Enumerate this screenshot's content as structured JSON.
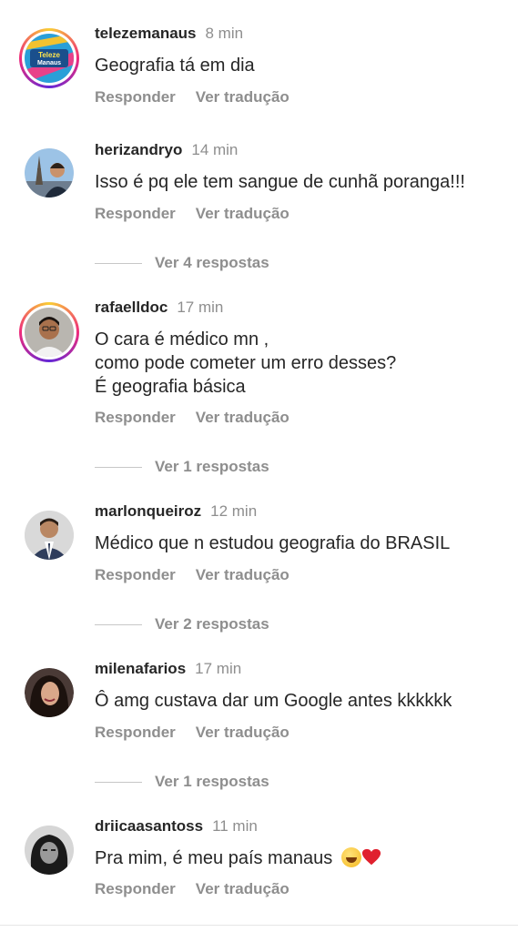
{
  "comments": [
    {
      "username": "telezemanaus",
      "time": "8 min",
      "text_lines": [
        "Geografia tá em dia"
      ],
      "reply_label": "Responder",
      "translate_label": "Ver tradução",
      "avatar_logo_lines": [
        "Teleze",
        "Manaus"
      ]
    },
    {
      "username": "herizandryo",
      "time": "14 min",
      "text_lines": [
        "Isso é pq ele tem sangue de cunhã poranga!!!"
      ],
      "reply_label": "Responder",
      "translate_label": "Ver tradução",
      "replies_label": "Ver 4 respostas"
    },
    {
      "username": "rafaelldoc",
      "time": "17 min",
      "text_lines": [
        "O cara é médico mn ,",
        "como pode cometer um erro desses?",
        "É geografia básica"
      ],
      "reply_label": "Responder",
      "translate_label": "Ver tradução",
      "replies_label": "Ver 1 respostas"
    },
    {
      "username": "marlonqueiroz",
      "time": "12 min",
      "text_lines": [
        "Médico que n estudou geografia do BRASIL"
      ],
      "reply_label": "Responder",
      "translate_label": "Ver tradução",
      "replies_label": "Ver 2 respostas"
    },
    {
      "username": "milenafarios",
      "time": "17 min",
      "text_lines": [
        "Ô amg custava dar um Google antes kkkkkk"
      ],
      "reply_label": "Responder",
      "translate_label": "Ver tradução",
      "replies_label": "Ver 1 respostas"
    },
    {
      "username": "driicaasantoss",
      "time": "11 min",
      "text_lines": [
        "Pra mim, é meu país manaus"
      ],
      "reply_label": "Responder",
      "translate_label": "Ver tradução"
    }
  ],
  "colors": {
    "text": "#262626",
    "muted": "#8e8e8e",
    "story_ring_start": "#f9ce34",
    "story_ring_mid": "#ee2a7b",
    "story_ring_end": "#6228d7"
  },
  "icons": [
    "laughing-emoji-icon",
    "red-heart-icon"
  ]
}
